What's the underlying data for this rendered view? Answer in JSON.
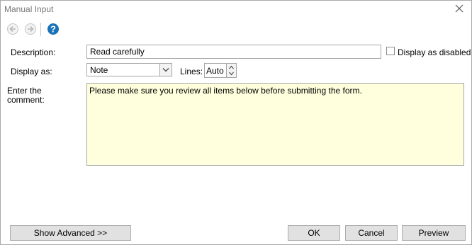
{
  "window": {
    "title": "Manual Input"
  },
  "toolbar": {
    "back_icon": "back-arrow-icon",
    "forward_icon": "forward-arrow-icon",
    "help_icon": "help-icon"
  },
  "form": {
    "description_label": "Description:",
    "description_value": "Read carefully",
    "display_disabled_label": "Display as disabled",
    "display_disabled_checked": false,
    "display_as_label": "Display as:",
    "display_as_value": "Note",
    "lines_label": "Lines:",
    "lines_value": "Auto",
    "comment_label_line1": "Enter the",
    "comment_label_line2": "comment:",
    "comment_value": "Please make sure you review all items below before submitting the form."
  },
  "footer": {
    "show_advanced_label": "Show Advanced >>",
    "ok_label": "OK",
    "cancel_label": "Cancel",
    "preview_label": "Preview"
  },
  "colors": {
    "comment_background": "#ffffdd",
    "help_icon": "#1a73b8"
  }
}
